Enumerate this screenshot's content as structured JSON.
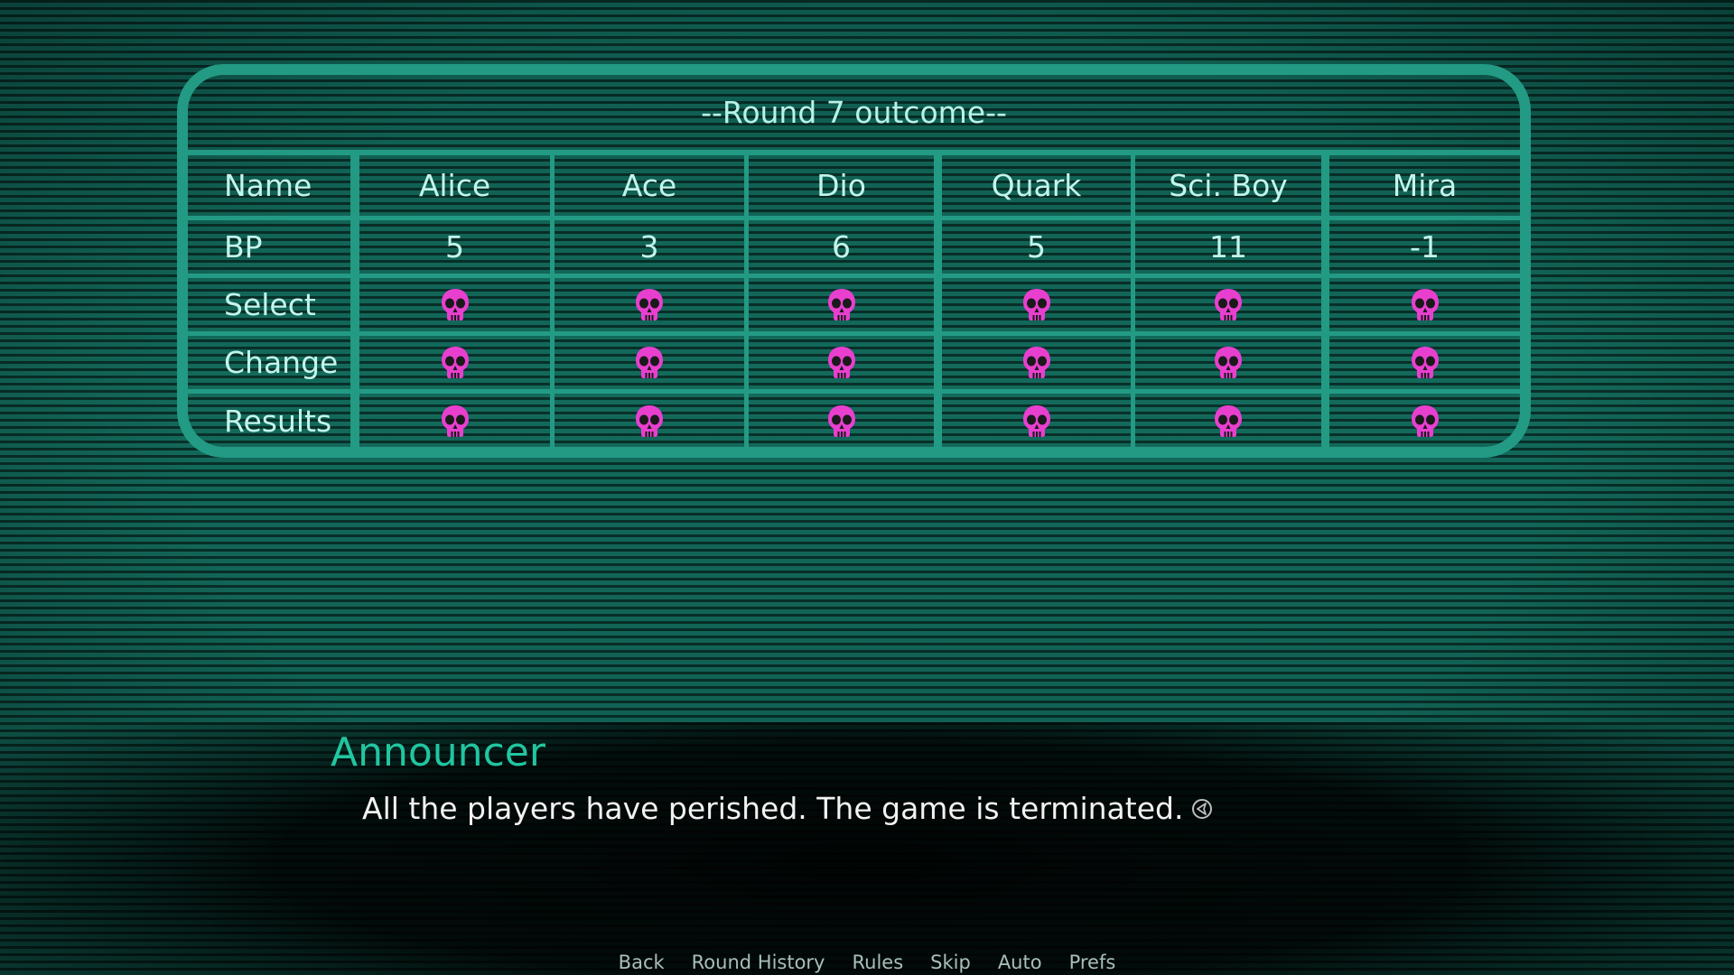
{
  "board": {
    "title": "--Round 7 outcome--",
    "row_labels": {
      "name": "Name",
      "bp": "BP",
      "select": "Select",
      "change": "Change",
      "results": "Results"
    },
    "players": [
      {
        "name": "Alice",
        "bp": "5",
        "select": "skull",
        "change": "skull",
        "results": "skull"
      },
      {
        "name": "Ace",
        "bp": "3",
        "select": "skull",
        "change": "skull",
        "results": "skull"
      },
      {
        "name": "Dio",
        "bp": "6",
        "select": "skull",
        "change": "skull",
        "results": "skull"
      },
      {
        "name": "Quark",
        "bp": "5",
        "select": "skull",
        "change": "skull",
        "results": "skull"
      },
      {
        "name": "Sci. Boy",
        "bp": "11",
        "select": "skull",
        "change": "skull",
        "results": "skull"
      },
      {
        "name": "Mira",
        "bp": "-1",
        "select": "skull",
        "change": "skull",
        "results": "skull"
      }
    ]
  },
  "dialogue": {
    "speaker": "Announcer",
    "text": "All the players have perished. The game is terminated."
  },
  "quick_menu": [
    "Back",
    "Round History",
    "Rules",
    "Skip",
    "Auto",
    "Prefs"
  ],
  "colors": {
    "accent": "#239a84",
    "speaker": "#21c6a0",
    "skull": "#e83fcf"
  }
}
